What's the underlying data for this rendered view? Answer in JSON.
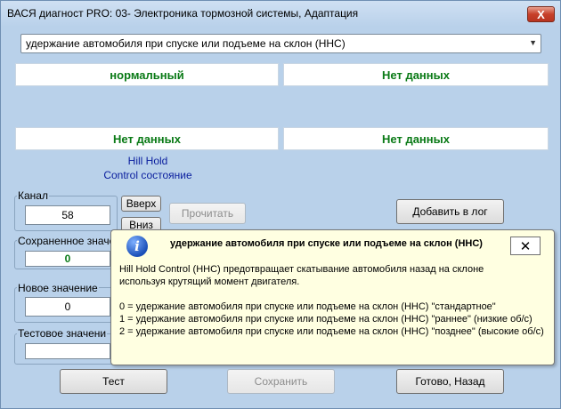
{
  "window": {
    "title": "ВАСЯ диагност PRO: 03- Электроника тормозной системы, Адаптация",
    "close_glyph": "X"
  },
  "combo": {
    "selected": "удержание автомобиля при спуске или подъеме на склон (HHC)",
    "arrow": "▼"
  },
  "values": {
    "top_left": "нормальный",
    "top_right": "Нет данных",
    "bottom_left": "Нет данных",
    "bottom_right": "Нет данных"
  },
  "caption": {
    "line1": "Hill Hold",
    "line2": "Control состояние"
  },
  "channel": {
    "label": "Канал",
    "value": "58",
    "up_label": "Вверх",
    "down_label": "Вниз",
    "read_label": "Прочитать",
    "add_log_label": "Добавить в лог"
  },
  "saved": {
    "label": "Сохраненное значение",
    "value": "0"
  },
  "new_value": {
    "label": "Новое значение",
    "value": "0"
  },
  "test_value": {
    "label": "Тестовое значени"
  },
  "buttons": {
    "test": "Тест",
    "save": "Сохранить",
    "done": "Готово, Назад"
  },
  "tooltip": {
    "icon_glyph": "i",
    "title": "удержание автомобиля при спуске или подъеме на склон (HHC)",
    "close_glyph": "✕",
    "desc1": "Hill Hold Control (HHC) предотвращает скатывание автомобиля назад на склоне",
    "desc2": "используя крутящий момент двигателя.",
    "opt0": "0 = удержание автомобиля при спуске или подъеме на склон (HHC) \"стандартное\"",
    "opt1": "1 = удержание автомобиля при спуске или подъеме на склон (HHC) \"раннее\" (низкие об/с)",
    "opt2": "2 = удержание автомобиля при спуске или подъеме на склон (HHC) \"позднее\" (высокие об/с)"
  },
  "colors": {
    "window_bg": "#b9d1ea",
    "value_green": "#0a7a16",
    "caption_blue": "#0a1e9e",
    "tooltip_bg": "#ffffe1"
  }
}
